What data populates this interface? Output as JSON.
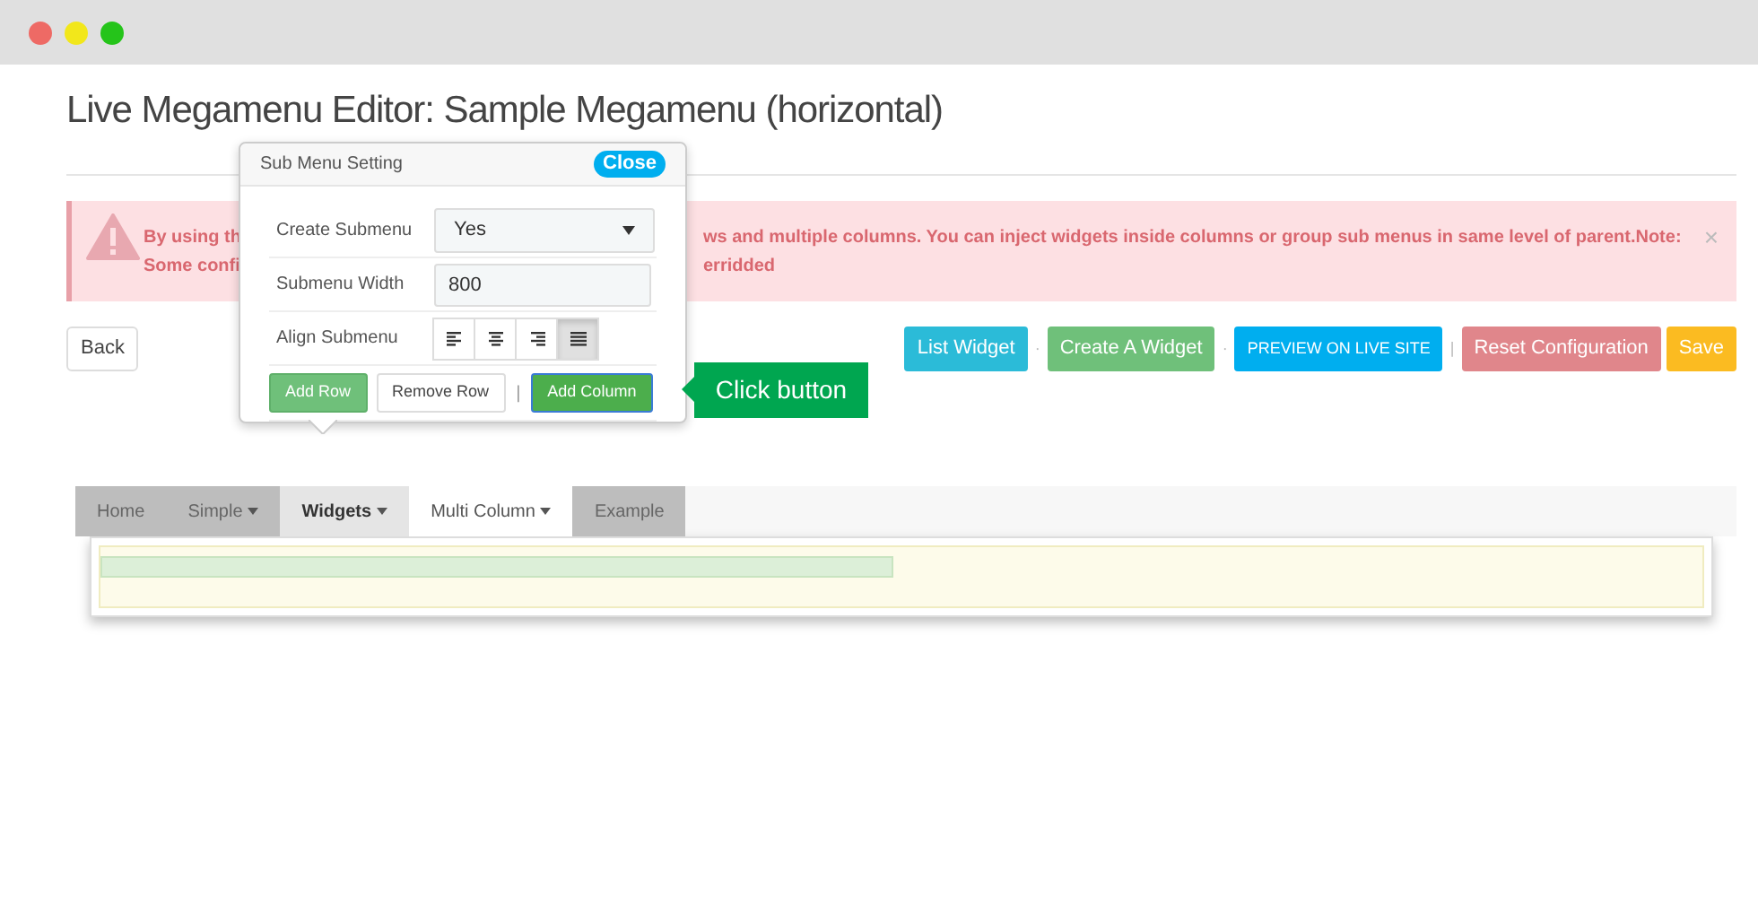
{
  "title": "Live Megamenu Editor: Sample Megamenu (horizontal)",
  "alert": {
    "line_1_start": "By using th",
    "line_1_end": "ws and multiple columns. You can inject widgets inside columns or group sub menus in same level of parent.Note:",
    "line_2_start": "Some confi",
    "line_2_end": "erridded",
    "close": "×"
  },
  "back_button": "Back",
  "actions": [
    {
      "label": "List Widget",
      "color": "#2bbbd8"
    },
    {
      "separator": "·",
      "label": "Create A Widget",
      "color": "#6fc07a"
    },
    {
      "separator": "·",
      "label": "PREVIEW ON LIVE SITE",
      "color": "#00aeef"
    },
    {
      "separator": "|",
      "label": "Reset Configuration",
      "color": "#e0868b"
    },
    {
      "label": "Save",
      "color": "#fbbb21"
    }
  ],
  "popover": {
    "title": "Sub Menu Setting",
    "close": "Close",
    "fields": [
      {
        "label": "Create Submenu",
        "kind": "select",
        "value": "Yes"
      },
      {
        "label": "Submenu Width",
        "kind": "input",
        "value": "800"
      },
      {
        "label": "Align Submenu",
        "kind": "align",
        "options": [
          {
            "selected": false
          },
          {
            "selected": false
          },
          {
            "selected": false
          },
          {
            "selected": true
          }
        ]
      }
    ],
    "buttons": [
      {
        "label": "Add Row",
        "kind": "primary"
      },
      {
        "label": "Remove Row",
        "kind": "default"
      },
      {
        "separator": "|",
        "label": "Add Column",
        "kind": "focused"
      }
    ]
  },
  "callout": "Click button",
  "nav": [
    {
      "label": "Home",
      "caret": false,
      "selected": false,
      "kind": "grey"
    },
    {
      "label": "Simple",
      "caret": true,
      "selected": false,
      "kind": "grey"
    },
    {
      "label": "Widgets",
      "caret": true,
      "selected": true,
      "kind": "light"
    },
    {
      "label": "Multi Column",
      "caret": true,
      "selected": false,
      "kind": "plain"
    },
    {
      "label": "Example",
      "caret": false,
      "selected": false,
      "kind": "grey"
    }
  ]
}
